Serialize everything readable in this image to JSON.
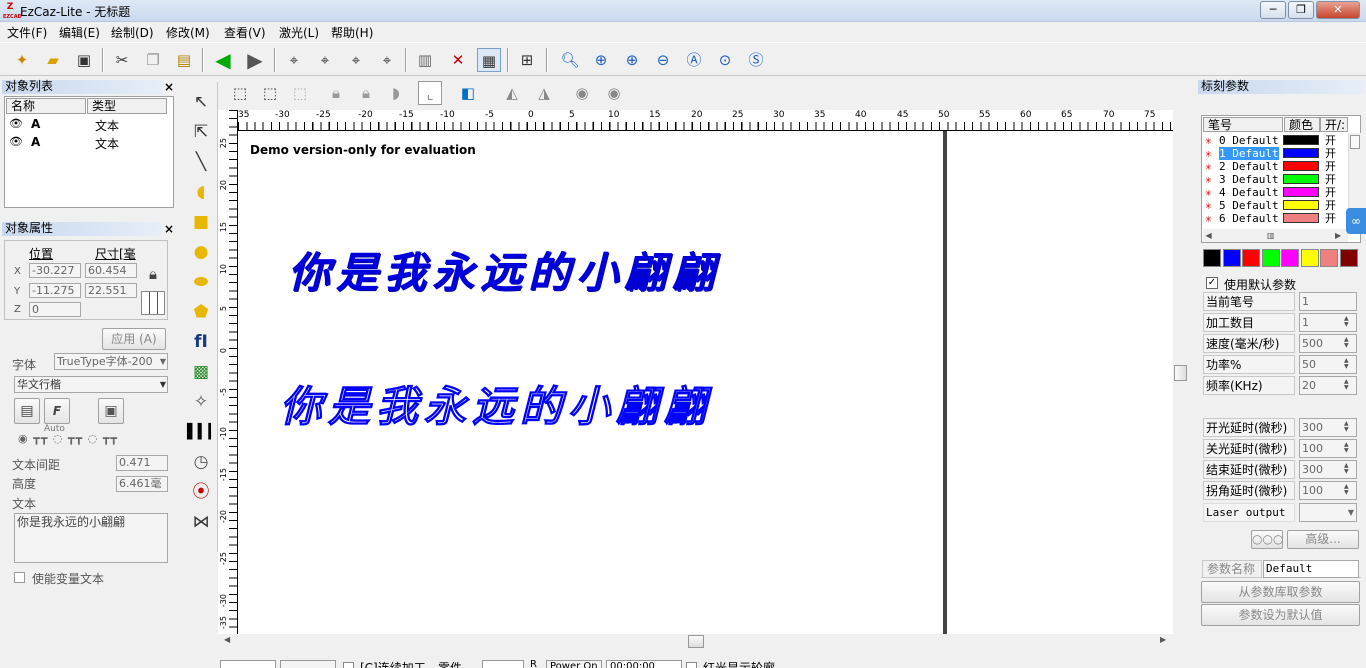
{
  "window": {
    "title": "EzCaz-Lite  - 无标题",
    "logo_text": "EZCAD",
    "minimize": "─",
    "maximize": "❐",
    "close": "✕"
  },
  "menu": [
    "文件(F)",
    "编辑(E)",
    "绘制(D)",
    "修改(M)",
    "查看(V)",
    "激光(L)",
    "帮助(H)"
  ],
  "object_list": {
    "title": "对象列表",
    "col_name": "名称",
    "col_type": "类型",
    "rows": [
      {
        "name": "A",
        "type": "文本"
      },
      {
        "name": "A",
        "type": "文本"
      }
    ]
  },
  "object_props": {
    "title": "对象属性",
    "pos_label": "位置",
    "size_label": "尺寸[毫",
    "x_label": "X",
    "y_label": "Y",
    "z_label": "Z",
    "x_pos": "-30.227",
    "x_size": "60.454",
    "y_pos": "-11.275",
    "y_size": "22.551",
    "z_pos": "0",
    "apply": "应用 (A)",
    "font_label": "字体",
    "font_type": "TrueType字体-200",
    "font_name": "华文行楷",
    "auto_label": "Auto",
    "spacing_label": "文本间距",
    "spacing_value": "0.471",
    "height_label": "高度",
    "height_value": "6.461毫",
    "text_label": "文本",
    "text_value": "你是我永远的小翩翩",
    "var_text": "使能变量文本"
  },
  "canvas": {
    "demo": "Demo version-only for evaluation",
    "text_line": "你是我永远的小翩翩",
    "ruler_h": [
      "35",
      "-30",
      "-25",
      "-20",
      "-15",
      "-10",
      "-5",
      "0",
      "5",
      "10",
      "15",
      "20",
      "25",
      "30",
      "35",
      "40",
      "45",
      "50",
      "55",
      "60",
      "65",
      "70",
      "75"
    ],
    "ruler_v": [
      "25",
      "20",
      "15",
      "10",
      "5",
      "0",
      "-5",
      "-10",
      "-15",
      "-20",
      "-25",
      "-30",
      "-35"
    ]
  },
  "mark_params": {
    "title": "标刻参数",
    "col_pen": "笔号",
    "col_color": "颜色",
    "col_onoff": "开/:",
    "pens": [
      {
        "label": "0 Default",
        "color": "#000000",
        "on": "开"
      },
      {
        "label": "1 Default",
        "color": "#0000ff",
        "on": "开"
      },
      {
        "label": "2 Default",
        "color": "#ff0000",
        "on": "开"
      },
      {
        "label": "3 Default",
        "color": "#00ff00",
        "on": "开"
      },
      {
        "label": "4 Default",
        "color": "#ff00ff",
        "on": "开"
      },
      {
        "label": "5 Default",
        "color": "#ffff00",
        "on": "开"
      },
      {
        "label": "6 Default",
        "color": "#f08080",
        "on": "开"
      }
    ],
    "palette": [
      "#000000",
      "#0000ff",
      "#ff0000",
      "#00ff00",
      "#ff00ff",
      "#ffff00",
      "#f08080",
      "#800000"
    ],
    "use_default": "使用默认参数",
    "params": [
      {
        "label": "当前笔号",
        "value": "1"
      },
      {
        "label": "加工数目",
        "value": "1"
      },
      {
        "label": "速度(毫米/秒)",
        "value": "500"
      },
      {
        "label": "功率%",
        "value": "50"
      },
      {
        "label": "频率(KHz)",
        "value": "20"
      }
    ],
    "delays": [
      {
        "label": "开光延时(微秒)",
        "value": "300"
      },
      {
        "label": "关光延时(微秒)",
        "value": "100"
      },
      {
        "label": "结束延时(微秒)",
        "value": "300"
      },
      {
        "label": "拐角延时(微秒)",
        "value": "100"
      }
    ],
    "laser_output": "Laser output",
    "advanced": "高级...",
    "param_name_label": "参数名称",
    "param_name_value": "Default",
    "from_lib": "从参数库取参数",
    "set_default": "参数设为默认值"
  },
  "statusbar": {
    "continuous": "[C]连续加工",
    "parts": "零件",
    "power_on": "Power On",
    "time": "00:00:00",
    "red_light": "红光显示轮廓"
  }
}
